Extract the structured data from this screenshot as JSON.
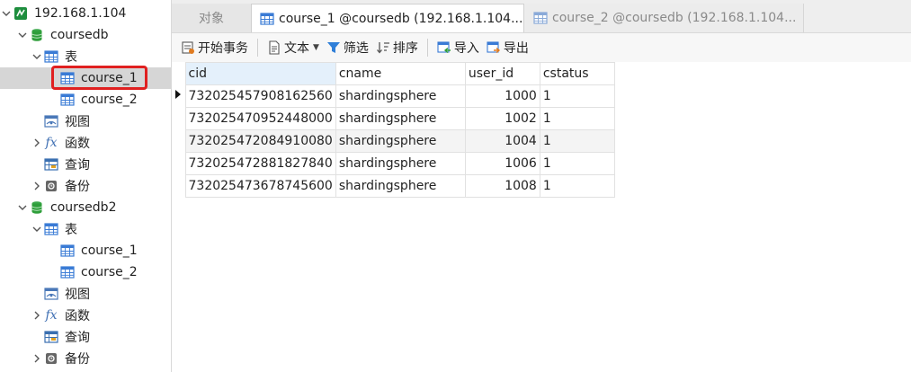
{
  "sidebar": {
    "connection": "192.168.1.104",
    "db1": {
      "name": "coursedb",
      "tables_label": "表",
      "tables": [
        "course_1",
        "course_2"
      ],
      "views": "视图",
      "functions": "函数",
      "queries": "查询",
      "backups": "备份"
    },
    "db2": {
      "name": "coursedb2",
      "tables_label": "表",
      "tables": [
        "course_1",
        "course_2"
      ],
      "views": "视图",
      "functions": "函数",
      "queries": "查询",
      "backups": "备份"
    },
    "selected": "course_1"
  },
  "tabs": {
    "objects": "对象",
    "active": "course_1 @coursedb (192.168.1.104...",
    "inactive": "course_2 @coursedb (192.168.1.104..."
  },
  "toolbar": {
    "begin_transaction": "开始事务",
    "text": "文本",
    "filter": "筛选",
    "sort": "排序",
    "import": "导入",
    "export": "导出"
  },
  "grid": {
    "columns": [
      "cid",
      "cname",
      "user_id",
      "cstatus"
    ],
    "rows": [
      [
        "732025457908162560",
        "shardingsphere",
        "1000",
        "1"
      ],
      [
        "732025470952448000",
        "shardingsphere",
        "1002",
        "1"
      ],
      [
        "732025472084910080",
        "shardingsphere",
        "1004",
        "1"
      ],
      [
        "732025472881827840",
        "shardingsphere",
        "1006",
        "1"
      ],
      [
        "732025473678745600",
        "shardingsphere",
        "1008",
        "1"
      ]
    ]
  },
  "colors": {
    "selection": "#d6d6d6",
    "highlight_border": "#e02020",
    "db_icon": "#2e9e3a",
    "table_icon": "#3a7bd5"
  },
  "icons": {
    "connection": "mysql-connection-icon",
    "database": "database-icon",
    "table": "table-icon",
    "view": "view-icon",
    "function": "function-icon",
    "query": "query-icon",
    "backup": "backup-icon"
  }
}
